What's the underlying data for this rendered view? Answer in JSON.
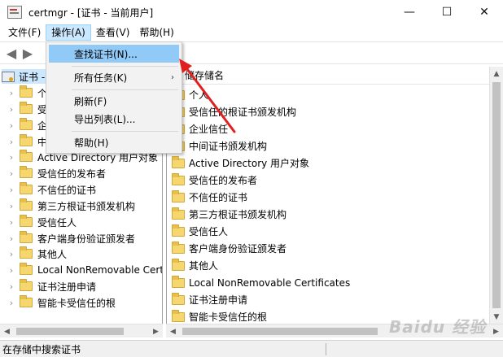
{
  "window": {
    "title": "certmgr - [证书 - 当前用户]",
    "minimize": "—",
    "maximize": "☐",
    "close": "✕"
  },
  "menubar": {
    "items": [
      {
        "label": "文件(F)"
      },
      {
        "label": "操作(A)"
      },
      {
        "label": "查看(V)"
      },
      {
        "label": "帮助(H)"
      }
    ]
  },
  "toolbar": {
    "back": "◀",
    "forward": "▶"
  },
  "tree": {
    "root_label": "证书 -",
    "items": [
      {
        "label": "个"
      },
      {
        "label": "受"
      },
      {
        "label": "企"
      },
      {
        "label": "中"
      },
      {
        "label": "Active Directory 用户对象"
      },
      {
        "label": "受信任的发布者"
      },
      {
        "label": "不信任的证书"
      },
      {
        "label": "第三方根证书颁发机构"
      },
      {
        "label": "受信任人"
      },
      {
        "label": "客户端身份验证颁发者"
      },
      {
        "label": "其他人"
      },
      {
        "label": "Local NonRemovable Cert"
      },
      {
        "label": "证书注册申请"
      },
      {
        "label": "智能卡受信任的根"
      }
    ]
  },
  "list": {
    "column_header": "储存储名",
    "items": [
      {
        "label": "个人"
      },
      {
        "label": "受信任的根证书颁发机构"
      },
      {
        "label": "企业信任"
      },
      {
        "label": "中间证书颁发机构"
      },
      {
        "label": "Active Directory 用户对象"
      },
      {
        "label": "受信任的发布者"
      },
      {
        "label": "不信任的证书"
      },
      {
        "label": "第三方根证书颁发机构"
      },
      {
        "label": "受信任人"
      },
      {
        "label": "客户端身份验证颁发者"
      },
      {
        "label": "其他人"
      },
      {
        "label": "Local NonRemovable Certificates"
      },
      {
        "label": "证书注册申请"
      },
      {
        "label": "智能卡受信任的根"
      }
    ]
  },
  "dropdown": {
    "items": [
      {
        "label": "查找证书(N)..."
      },
      {
        "label": "所有任务(K)"
      },
      {
        "label": "刷新(F)"
      },
      {
        "label": "导出列表(L)..."
      },
      {
        "label": "帮助(H)"
      }
    ],
    "submenu_glyph": "›"
  },
  "statusbar": {
    "text": "在存储中搜索证书"
  },
  "watermark": "Baidu 经验",
  "colors": {
    "menu_highlight": "#cce8ff",
    "dropdown_highlight": "#91c9f7",
    "annotation_arrow": "#e02020"
  }
}
